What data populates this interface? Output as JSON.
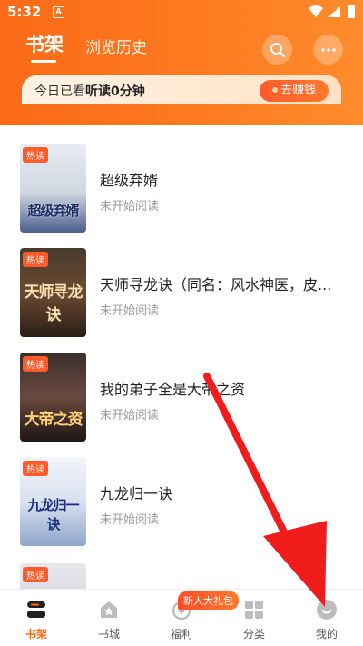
{
  "status_bar": {
    "time": "5:32",
    "notification_glyph": "A"
  },
  "header": {
    "tabs": [
      {
        "label": "书架",
        "active": true
      },
      {
        "label": "浏览历史",
        "active": false
      }
    ],
    "icons": [
      "search-icon",
      "more-icon"
    ]
  },
  "banner": {
    "text_prefix": "今日已看",
    "text_bold": "听读0分钟",
    "earn_button": "去赚钱"
  },
  "books": [
    {
      "badge": "热读",
      "cover_text": "超级弃婿",
      "title": "超级弃婿",
      "status": "未开始阅读"
    },
    {
      "badge": "热读",
      "cover_text": "天师寻龙诀",
      "title": "天师寻龙诀（同名：风水神医，皮...",
      "status": "未开始阅读"
    },
    {
      "badge": "热读",
      "cover_text": "大帝之资",
      "title": "我的弟子全是大帝之资",
      "status": "未开始阅读"
    },
    {
      "badge": "热读",
      "cover_text": "九龙归一诀",
      "title": "九龙归一诀",
      "status": "未开始阅读"
    },
    {
      "badge": "热读",
      "cover_text": "",
      "title": "",
      "status": ""
    }
  ],
  "tabbar": {
    "items": [
      {
        "label": "书架",
        "icon": "bookshelf-icon",
        "active": true
      },
      {
        "label": "书城",
        "icon": "bookstore-icon",
        "active": false
      },
      {
        "label": "福利",
        "icon": "welfare-icon",
        "active": false
      },
      {
        "label": "分类",
        "icon": "category-icon",
        "active": false
      },
      {
        "label": "我的",
        "icon": "profile-icon",
        "active": false
      }
    ],
    "gift_badge": "新人大礼包"
  },
  "colors": {
    "accent": "#ff6a1a",
    "header": "#fd7a20",
    "arrow": "#f01c1c"
  }
}
